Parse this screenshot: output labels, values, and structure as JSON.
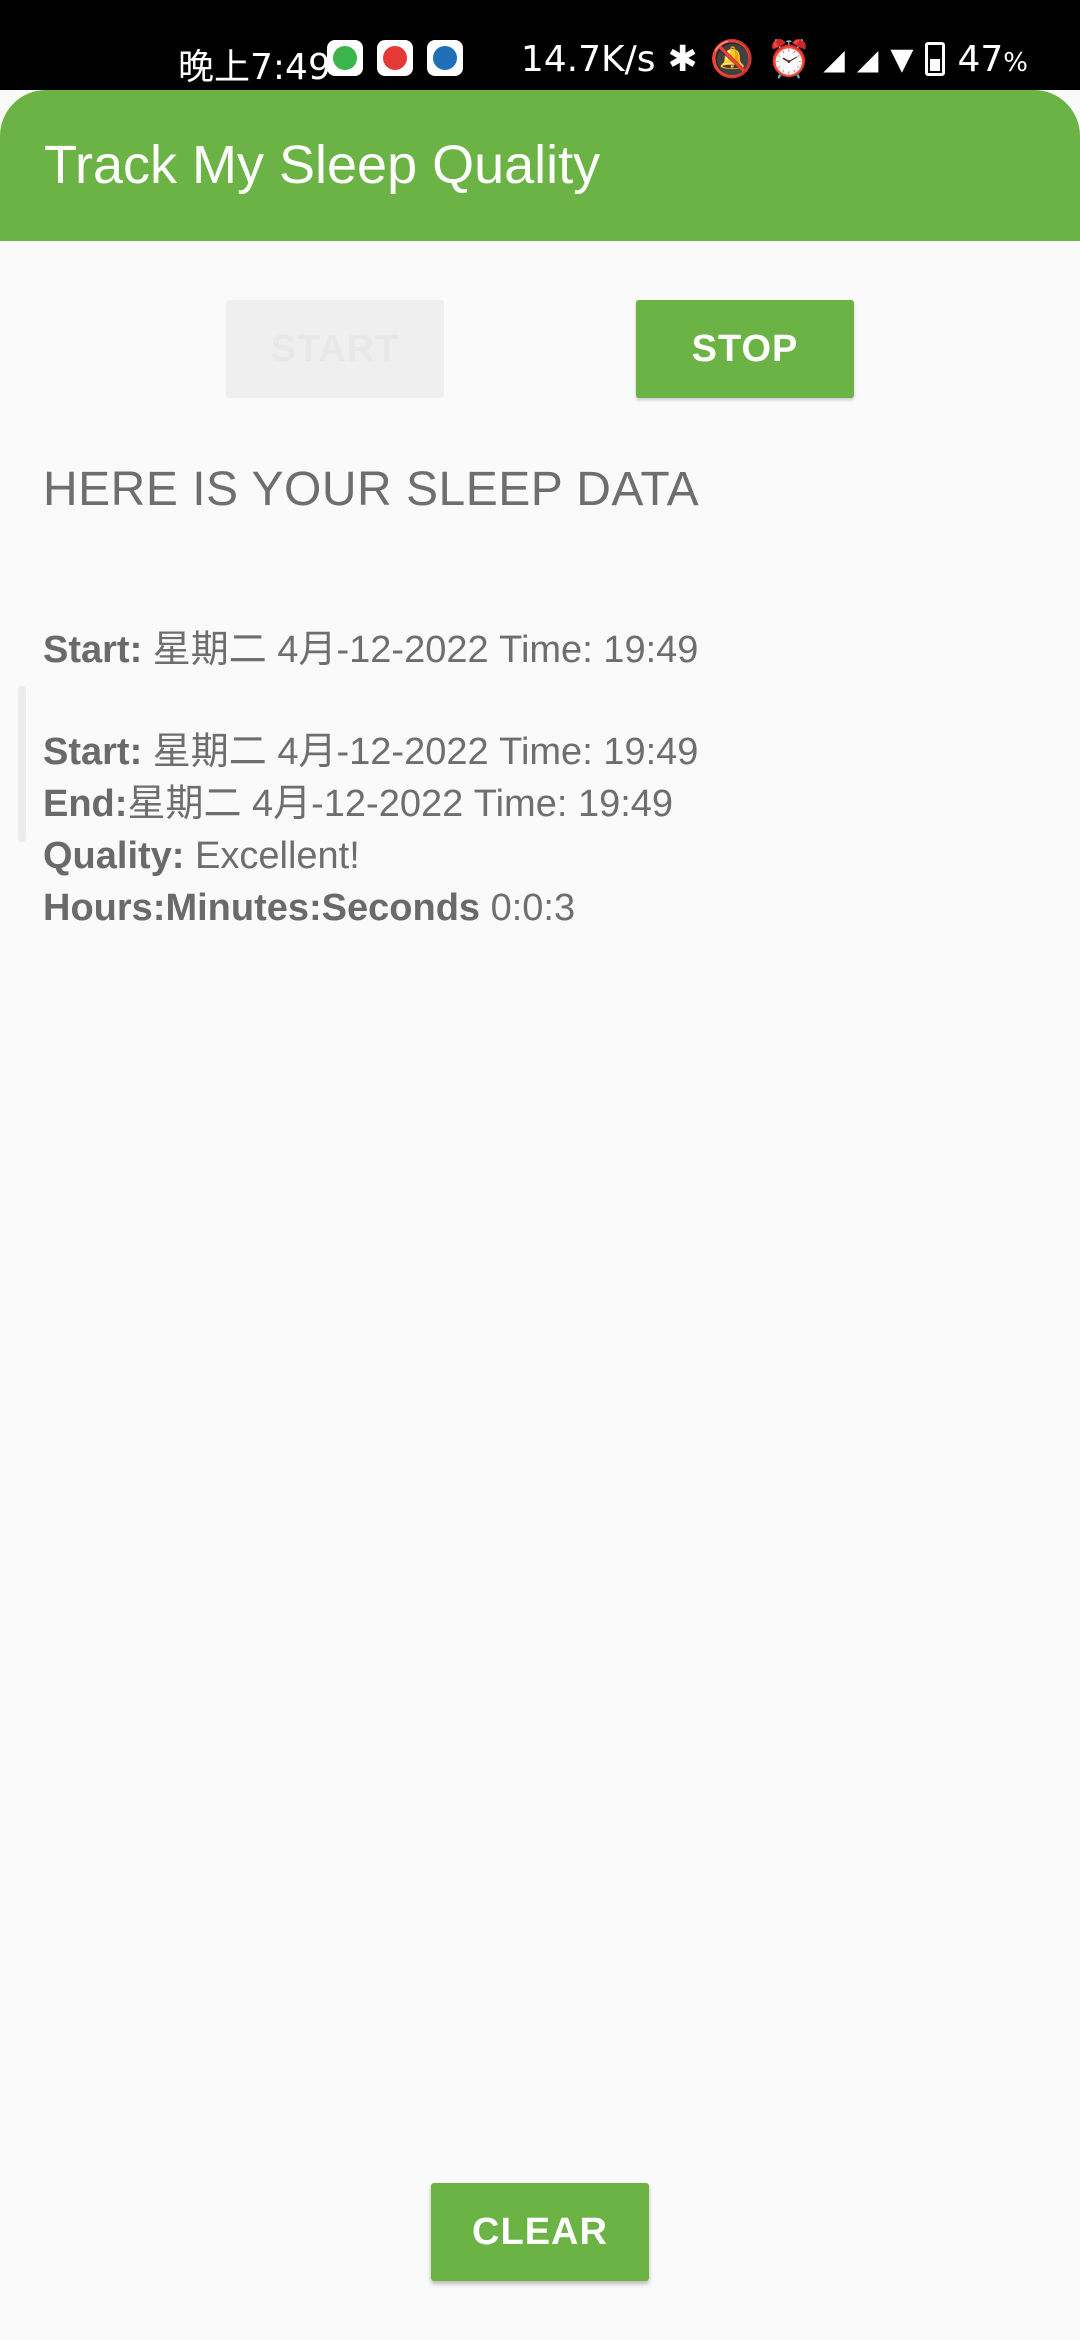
{
  "status_bar": {
    "time": "晚上7:49",
    "network_speed": "14.7K/s",
    "battery_percent": "47",
    "battery_unit": "%",
    "icons": [
      "bluetooth-icon",
      "mute-icon",
      "alarm-icon",
      "hd-signal-icon",
      "hd-signal-icon",
      "wifi-icon",
      "battery-icon"
    ]
  },
  "app_bar": {
    "title": "Track My Sleep Quality"
  },
  "buttons": {
    "start_label": "START",
    "stop_label": "STOP",
    "clear_label": "CLEAR"
  },
  "heading": "HERE IS YOUR SLEEP DATA",
  "entries": [
    {
      "start_label": "Start:",
      "start_value": "星期二 4月-12-2022 Time: 19:49"
    },
    {
      "start_label": "Start:",
      "start_value": "星期二 4月-12-2022 Time: 19:49",
      "end_label": "End:",
      "end_value": "星期二 4月-12-2022 Time: 19:49",
      "quality_label": "Quality:",
      "quality_value": "Excellent!",
      "duration_label": "Hours:Minutes:Seconds",
      "duration_value": "0:0:3"
    }
  ],
  "colors": {
    "primary": "#6ab344",
    "text": "#6e6e6e",
    "background": "#fafafa"
  }
}
